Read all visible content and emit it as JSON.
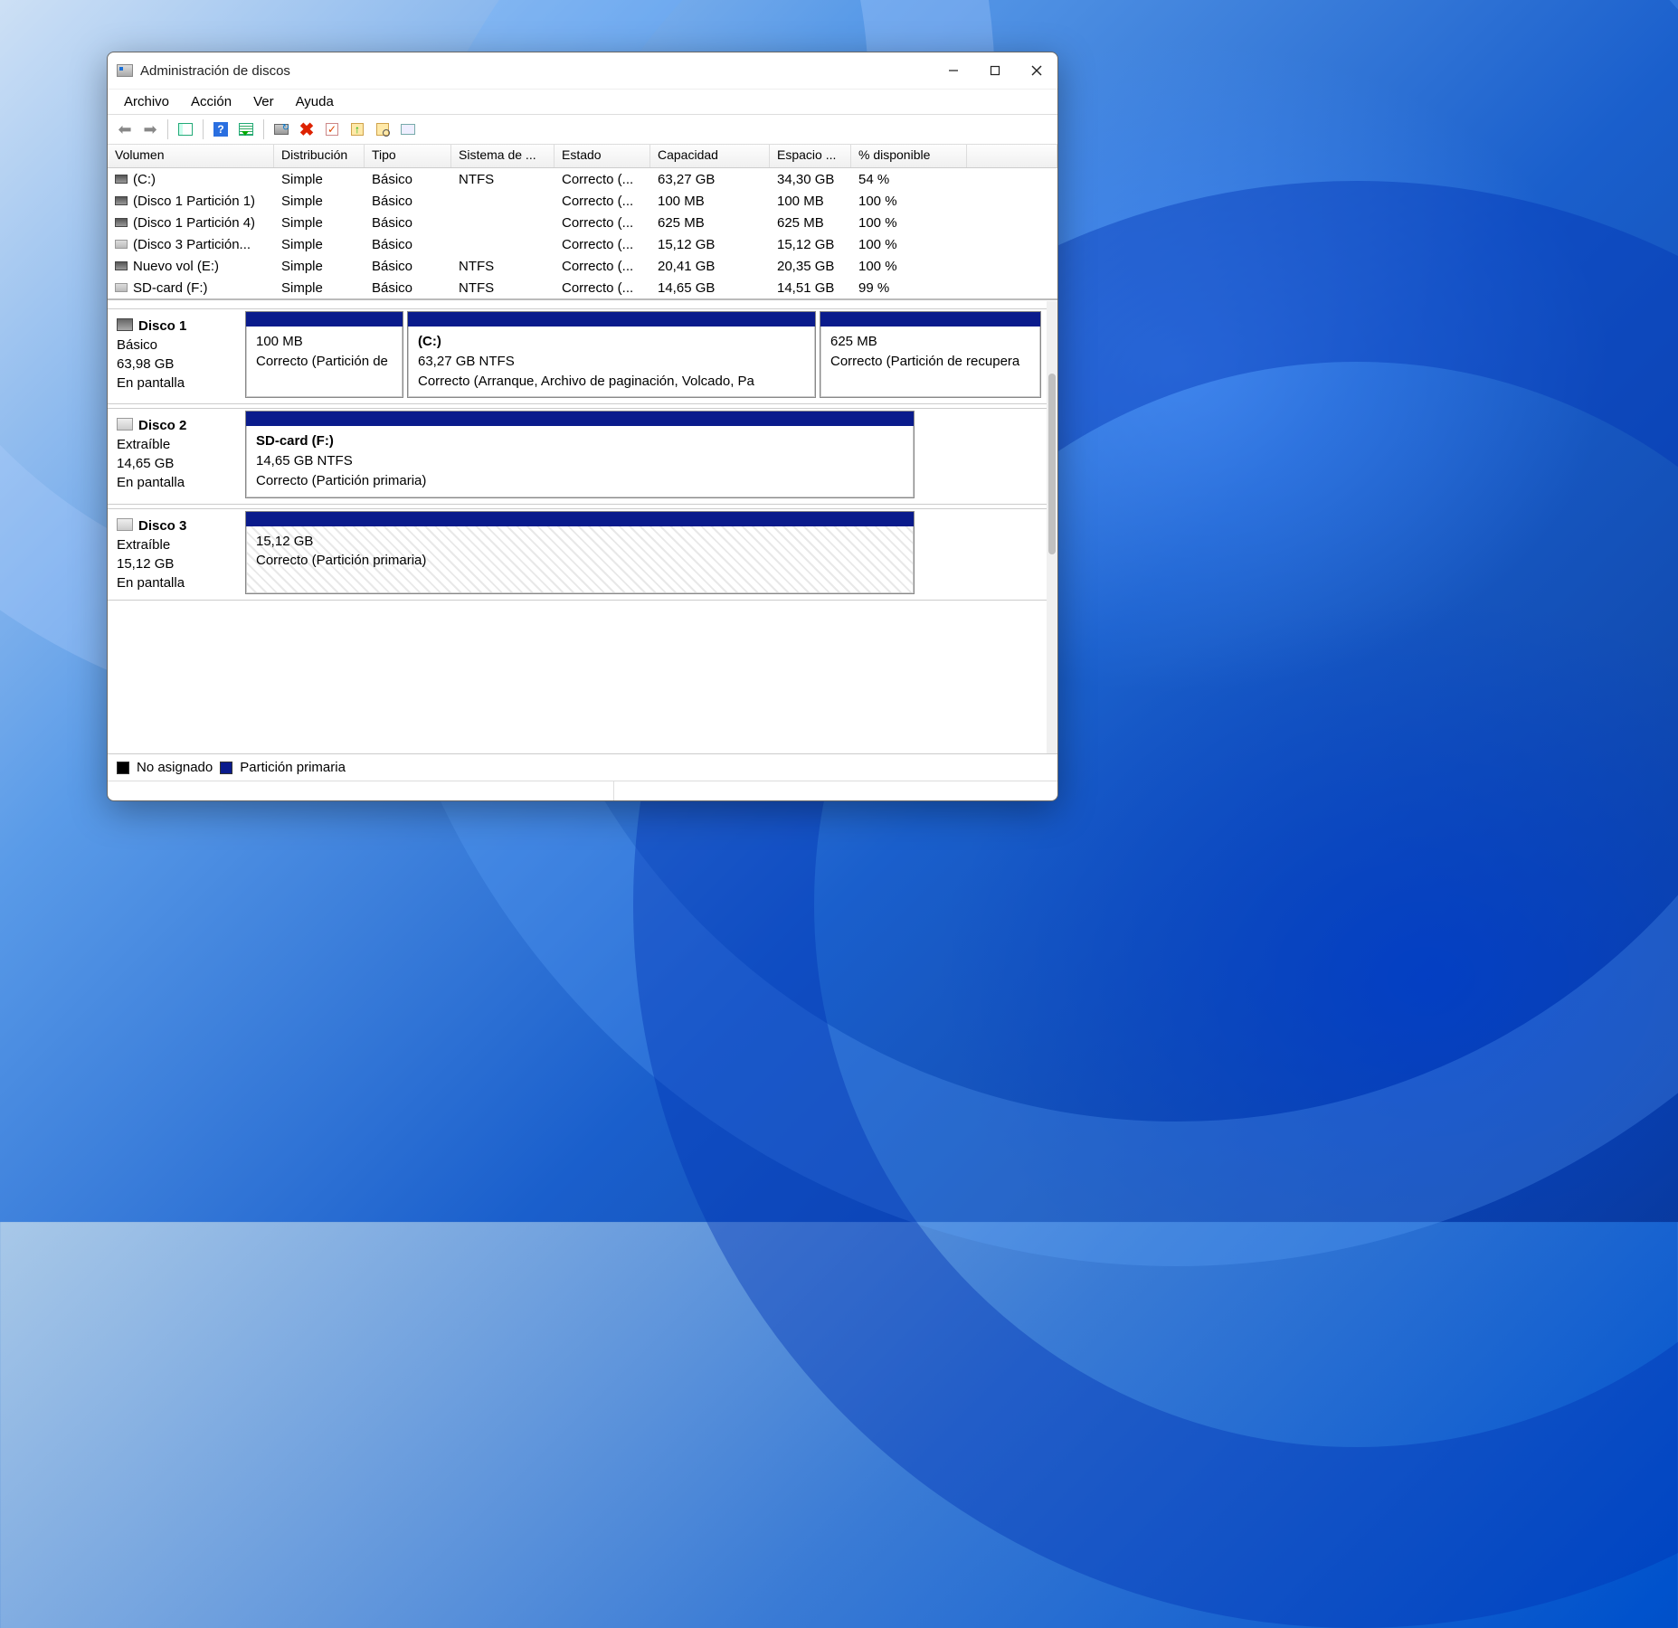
{
  "title": "Administración de discos",
  "menu": {
    "file": "Archivo",
    "action": "Acción",
    "view": "Ver",
    "help": "Ayuda"
  },
  "columns": [
    "Volumen",
    "Distribución",
    "Tipo",
    "Sistema de ...",
    "Estado",
    "Capacidad",
    "Espacio ...",
    "% disponible"
  ],
  "volumes": [
    {
      "icon": "dark",
      "name": "(C:)",
      "layout": "Simple",
      "type": "Básico",
      "fs": "NTFS",
      "status": "Correcto (...",
      "cap": "63,27 GB",
      "free": "34,30 GB",
      "pct": "54 %"
    },
    {
      "icon": "dark",
      "name": "(Disco 1 Partición 1)",
      "layout": "Simple",
      "type": "Básico",
      "fs": "",
      "status": "Correcto (...",
      "cap": "100 MB",
      "free": "100 MB",
      "pct": "100 %"
    },
    {
      "icon": "dark",
      "name": "(Disco 1 Partición 4)",
      "layout": "Simple",
      "type": "Básico",
      "fs": "",
      "status": "Correcto (...",
      "cap": "625 MB",
      "free": "625 MB",
      "pct": "100 %"
    },
    {
      "icon": "light",
      "name": "(Disco 3 Partición...",
      "layout": "Simple",
      "type": "Básico",
      "fs": "",
      "status": "Correcto (...",
      "cap": "15,12 GB",
      "free": "15,12 GB",
      "pct": "100 %"
    },
    {
      "icon": "dark",
      "name": "Nuevo vol (E:)",
      "layout": "Simple",
      "type": "Básico",
      "fs": "NTFS",
      "status": "Correcto (...",
      "cap": "20,41 GB",
      "free": "20,35 GB",
      "pct": "100 %"
    },
    {
      "icon": "light",
      "name": "SD-card (F:)",
      "layout": "Simple",
      "type": "Básico",
      "fs": "NTFS",
      "status": "Correcto (...",
      "cap": "14,65 GB",
      "free": "14,51 GB",
      "pct": "99 %"
    }
  ],
  "disks": {
    "d1": {
      "title": "Disco 1",
      "type": "Básico",
      "size": "63,98 GB",
      "state": "En pantalla",
      "p1": {
        "name": "",
        "size": "100 MB",
        "status": "Correcto (Partición de"
      },
      "p2": {
        "name": "(C:)",
        "size": "63,27 GB NTFS",
        "status": "Correcto (Arranque, Archivo de paginación, Volcado, Pa"
      },
      "p3": {
        "name": "",
        "size": "625 MB",
        "status": "Correcto (Partición de recupera"
      }
    },
    "d2": {
      "title": "Disco 2",
      "type": "Extraíble",
      "size": "14,65 GB",
      "state": "En pantalla",
      "p1": {
        "name": "SD-card  (F:)",
        "size": "14,65 GB NTFS",
        "status": "Correcto (Partición primaria)"
      }
    },
    "d3": {
      "title": "Disco 3",
      "type": "Extraíble",
      "size": "15,12 GB",
      "state": "En pantalla",
      "p1": {
        "name": "",
        "size": "15,12 GB",
        "status": "Correcto (Partición primaria)"
      }
    }
  },
  "legend": {
    "unalloc": "No asignado",
    "primary": "Partición primaria"
  }
}
